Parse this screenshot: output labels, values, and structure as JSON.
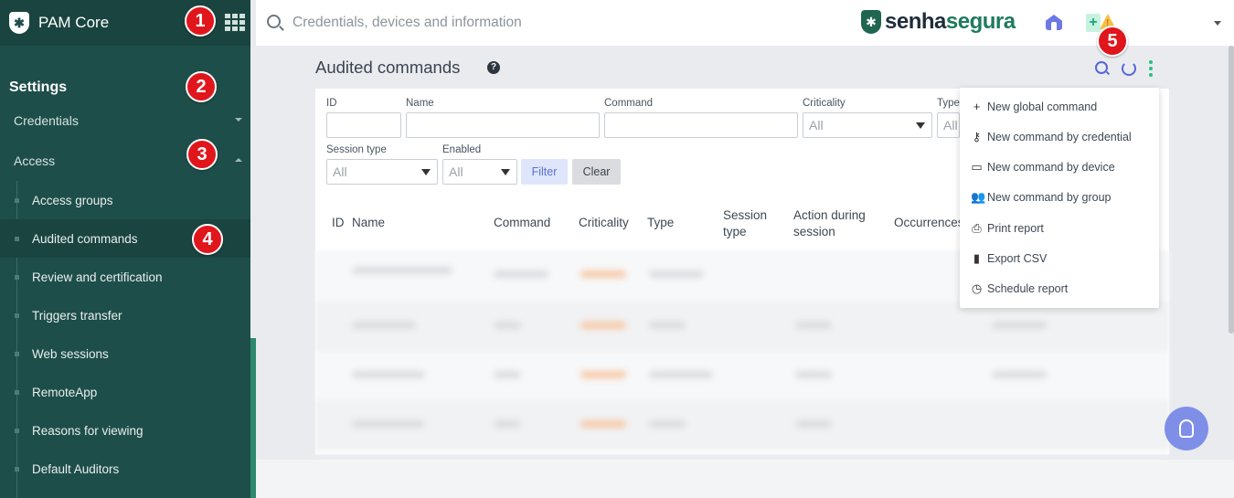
{
  "sidebar": {
    "app_name": "PAM Core",
    "settings_title": "Settings",
    "sections": [
      {
        "label": "Credentials",
        "expanded": false
      },
      {
        "label": "Access",
        "expanded": true
      }
    ],
    "items": [
      {
        "label": "Access groups"
      },
      {
        "label": "Audited commands",
        "active": true
      },
      {
        "label": "Review and certification"
      },
      {
        "label": "Triggers transfer"
      },
      {
        "label": "Web sessions"
      },
      {
        "label": "RemoteApp"
      },
      {
        "label": "Reasons for viewing"
      },
      {
        "label": "Default Auditors"
      }
    ]
  },
  "topbar": {
    "search_placeholder": "Credentials, devices and information",
    "brand_part1": "senha",
    "brand_part2": "segura",
    "plus_glyph": "+",
    "warn_glyph": "!"
  },
  "page": {
    "title": "Audited commands",
    "help_glyph": "?"
  },
  "filters": {
    "id_label": "ID",
    "name_label": "Name",
    "command_label": "Command",
    "criticality_label": "Criticality",
    "criticality_value": "All",
    "type_label": "Type",
    "type_value": "All",
    "session_type_label": "Session type",
    "session_type_value": "All",
    "enabled_label": "Enabled",
    "enabled_value": "All",
    "filter_button": "Filter",
    "clear_button": "Clear"
  },
  "table": {
    "columns": [
      "ID",
      "Name",
      "Command",
      "Criticality",
      "Type",
      "Session type",
      "Action during session",
      "Occurrences"
    ]
  },
  "menu": {
    "items": [
      {
        "label": "New global command",
        "icon": "plus-icon",
        "glyph": "+"
      },
      {
        "label": "New command by credential",
        "icon": "key-icon",
        "glyph": "⚷"
      },
      {
        "label": "New command by device",
        "icon": "laptop-icon",
        "glyph": "▭"
      },
      {
        "label": "New command by group",
        "icon": "users-icon",
        "glyph": "👥"
      },
      {
        "label": "Print report",
        "icon": "print-icon",
        "glyph": "⎙"
      },
      {
        "label": "Export CSV",
        "icon": "file-icon",
        "glyph": "▮"
      },
      {
        "label": "Schedule report",
        "icon": "clock-icon",
        "glyph": "◷"
      }
    ]
  },
  "markers": [
    "1",
    "2",
    "3",
    "4",
    "5"
  ],
  "colors": {
    "sidebar_bg": "#1e4e4a",
    "accent_green": "#26c281",
    "accent_blue": "#5566d8",
    "marker_red": "#e0161c"
  }
}
